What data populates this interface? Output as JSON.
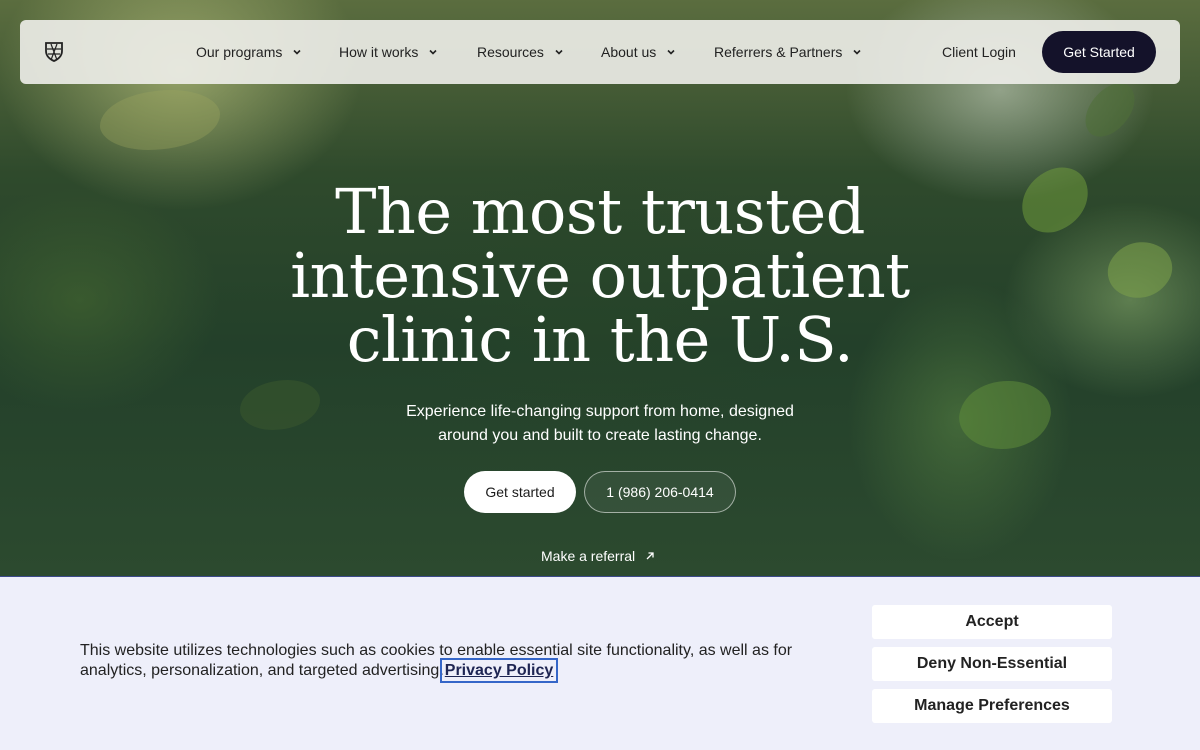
{
  "nav": {
    "logo": "shield-logo-icon",
    "items": [
      {
        "label": "Our programs"
      },
      {
        "label": "How it works"
      },
      {
        "label": "Resources"
      },
      {
        "label": "About us"
      },
      {
        "label": "Referrers & Partners"
      }
    ],
    "client_login": "Client Login",
    "cta": "Get Started"
  },
  "hero": {
    "headline_lines": [
      "The most trusted",
      "intensive outpatient",
      "clinic in the U.S."
    ],
    "subtext": "Experience life-changing support from home, designed around you and built to create lasting change.",
    "primary_button": "Get started",
    "phone_button": "1 (986) 206-0414",
    "referral_link": "Make a referral"
  },
  "cookie_banner": {
    "text": "This website utilizes technologies such as cookies to enable essential site functionality, as well as for analytics, personalization, and targeted advertising.",
    "privacy_link": "Privacy Policy",
    "buttons": {
      "accept": "Accept",
      "deny": "Deny Non-Essential",
      "manage": "Manage Preferences"
    }
  },
  "colors": {
    "nav_cta_bg": "#14122a",
    "cookie_bg": "#eeeffa",
    "link_focus": "#3566c8"
  }
}
